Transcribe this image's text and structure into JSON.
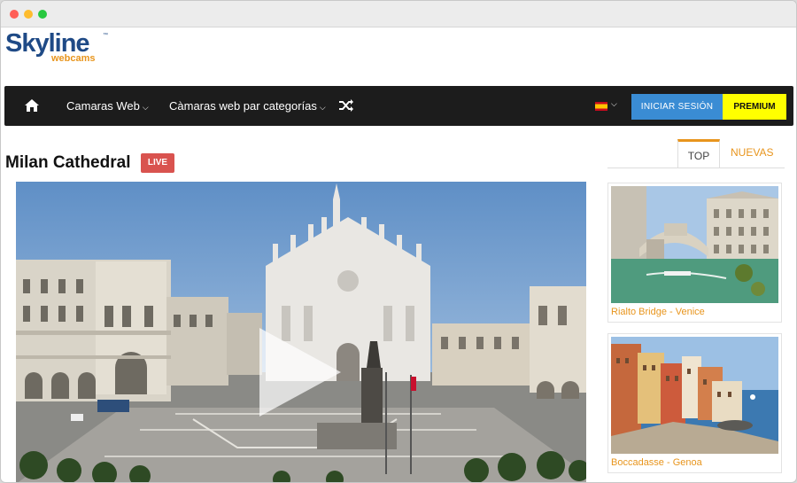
{
  "window": {
    "buttons": [
      "close",
      "minimize",
      "maximize"
    ]
  },
  "logo": {
    "main": "Skyline",
    "tm": "™",
    "sub": "webcams"
  },
  "nav": {
    "home_icon": "home-icon",
    "items": [
      {
        "label": "Camaras Web"
      },
      {
        "label": "Càmaras web par categorías"
      }
    ],
    "shuffle_icon": "shuffle-icon",
    "language_flag": "spain-flag-icon",
    "login_label": "INICIAR SESIÓN",
    "premium_label": "PREMIUM"
  },
  "page": {
    "title": "Milan Cathedral",
    "live_label": "LIVE"
  },
  "tabs": {
    "top": "TOP",
    "new": "NUEVAS"
  },
  "sidebar": {
    "cards": [
      {
        "caption": "Rialto Bridge - Venice"
      },
      {
        "caption": "Boccadasse - Genoa"
      }
    ]
  },
  "colors": {
    "accent": "#e8951d",
    "brand": "#1f4a86",
    "navbar": "#1c1c1c",
    "login": "#3a8cd4",
    "premium": "#ffff00",
    "live": "#d9534f"
  }
}
